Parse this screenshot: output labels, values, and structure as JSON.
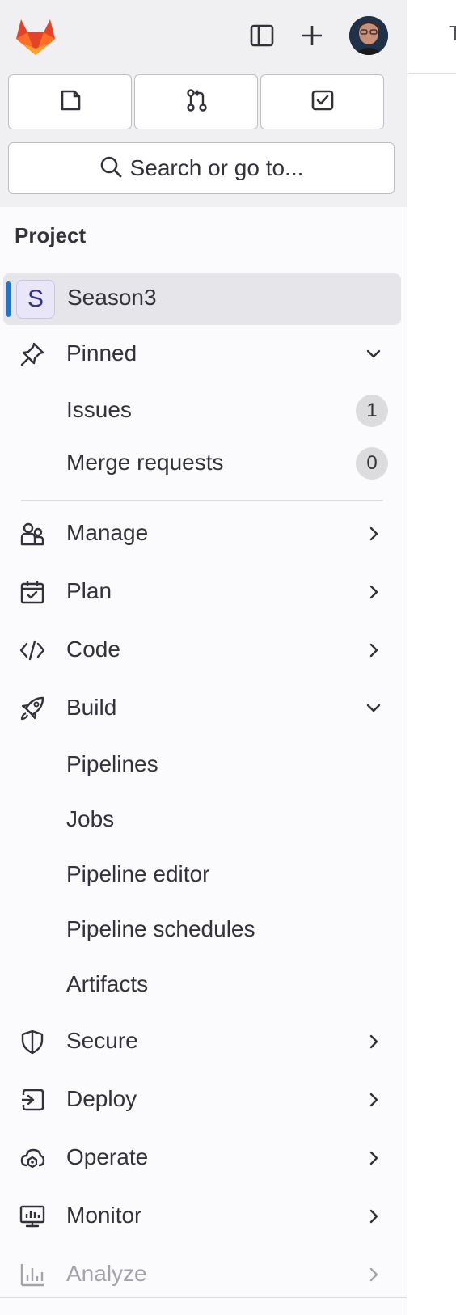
{
  "header": {
    "logo": "gitlab-tanuki-logo",
    "sidebar_toggle_icon": "sidebar-toggle-icon",
    "create_icon": "plus-icon",
    "avatar": "user-avatar"
  },
  "quick_actions": [
    {
      "name": "issues-icon"
    },
    {
      "name": "merge-request-icon"
    },
    {
      "name": "todo-icon"
    }
  ],
  "search": {
    "placeholder": "Search or go to..."
  },
  "section_title": "Project",
  "project": {
    "initial": "S",
    "name": "Season3"
  },
  "pinned": {
    "label": "Pinned",
    "items": [
      {
        "label": "Issues",
        "count": "1"
      },
      {
        "label": "Merge requests",
        "count": "0"
      }
    ]
  },
  "nav": {
    "manage": "Manage",
    "plan": "Plan",
    "code": "Code",
    "build": "Build",
    "build_items": [
      "Pipelines",
      "Jobs",
      "Pipeline editor",
      "Pipeline schedules",
      "Artifacts"
    ],
    "secure": "Secure",
    "deploy": "Deploy",
    "operate": "Operate",
    "monitor": "Monitor",
    "analyze": "Analyze"
  },
  "main": {
    "tab_fragment": "T"
  },
  "colors": {
    "accent": "#1f75cb",
    "text": "#333238",
    "sidebar_bg": "#fbfafd",
    "top_bg": "#f0f0f2",
    "faded_text": "#a4a3a8"
  }
}
